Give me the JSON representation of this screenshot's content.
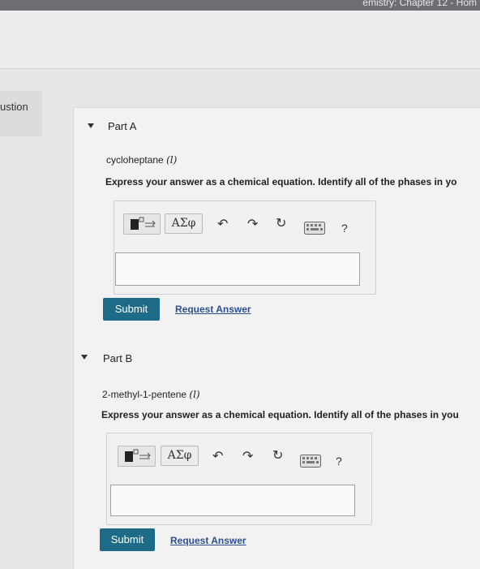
{
  "window": {
    "title_fragment": "emistry: Chapter 12 - Hom"
  },
  "sidebar": {
    "tab_label": "ustion"
  },
  "parts": [
    {
      "title": "Part A",
      "compound": "cycloheptane",
      "phase": "(l)",
      "instruction": "Express your answer as a chemical equation. Identify all of the phases in yo",
      "toolbar": {
        "greek_label": "ΑΣφ",
        "help_label": "?"
      },
      "answer_value": "",
      "submit_label": "Submit",
      "request_label": "Request Answer"
    },
    {
      "title": "Part B",
      "compound": "2-methyl-1-pentene",
      "phase": "(l)",
      "instruction": "Express your answer as a chemical equation. Identify all of the phases in you",
      "toolbar": {
        "greek_label": "ΑΣφ",
        "help_label": "?"
      },
      "answer_value": "",
      "submit_label": "Submit",
      "request_label": "Request Answer"
    }
  ]
}
